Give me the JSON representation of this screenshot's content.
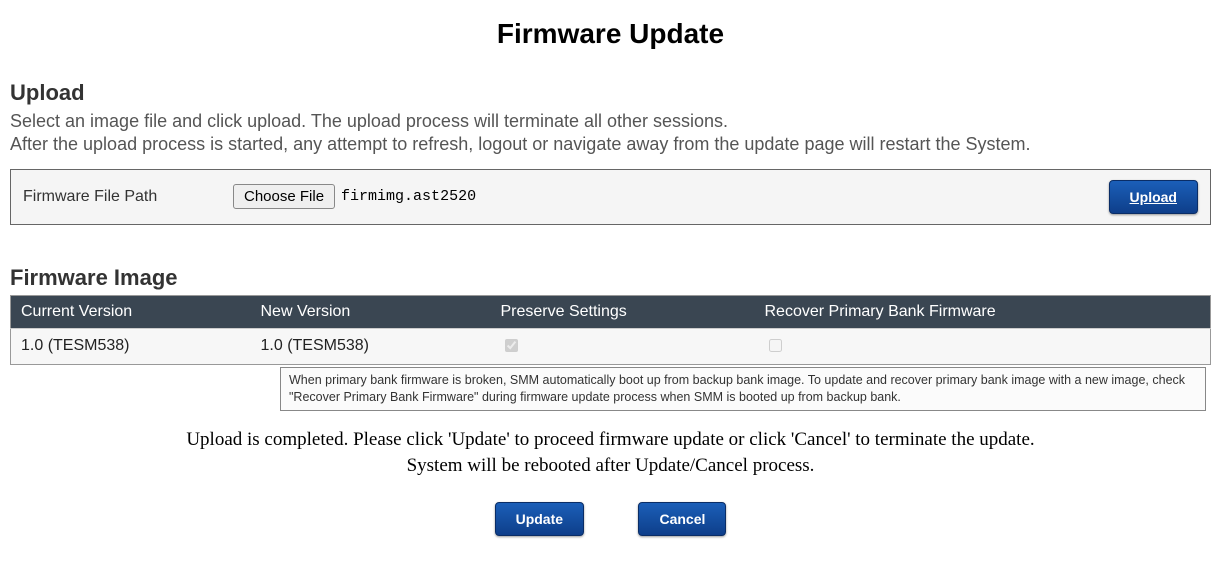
{
  "page": {
    "title": "Firmware Update"
  },
  "upload": {
    "heading": "Upload",
    "desc_line1": "Select an image file and click upload. The upload process will terminate all other sessions.",
    "desc_line2": "After the upload process is started, any attempt to refresh, logout or navigate away from the update page will restart the System.",
    "file_path_label": "Firmware File Path",
    "choose_label": "Choose File",
    "file_name": "firmimg.ast2520",
    "upload_button": "Upload"
  },
  "firmware_image": {
    "heading": "Firmware Image",
    "columns": {
      "current_version": "Current Version",
      "new_version": "New Version",
      "preserve_settings": "Preserve Settings",
      "recover_primary": "Recover Primary Bank Firmware"
    },
    "row": {
      "current_version": "1.0 (TESM538)",
      "new_version": "1.0 (TESM538)",
      "preserve_settings_checked": true,
      "recover_primary_checked": false
    },
    "tooltip": "When primary bank firmware is broken, SMM automatically boot up from backup bank image. To update and recover primary bank image with a new image, check \"Recover Primary Bank Firmware\" during firmware update process when SMM is booted up from backup bank."
  },
  "completion": {
    "line1": "Upload is completed. Please click 'Update' to proceed firmware update or click 'Cancel' to terminate the update.",
    "line2": "System will be rebooted after Update/Cancel process."
  },
  "actions": {
    "update": "Update",
    "cancel": "Cancel"
  }
}
